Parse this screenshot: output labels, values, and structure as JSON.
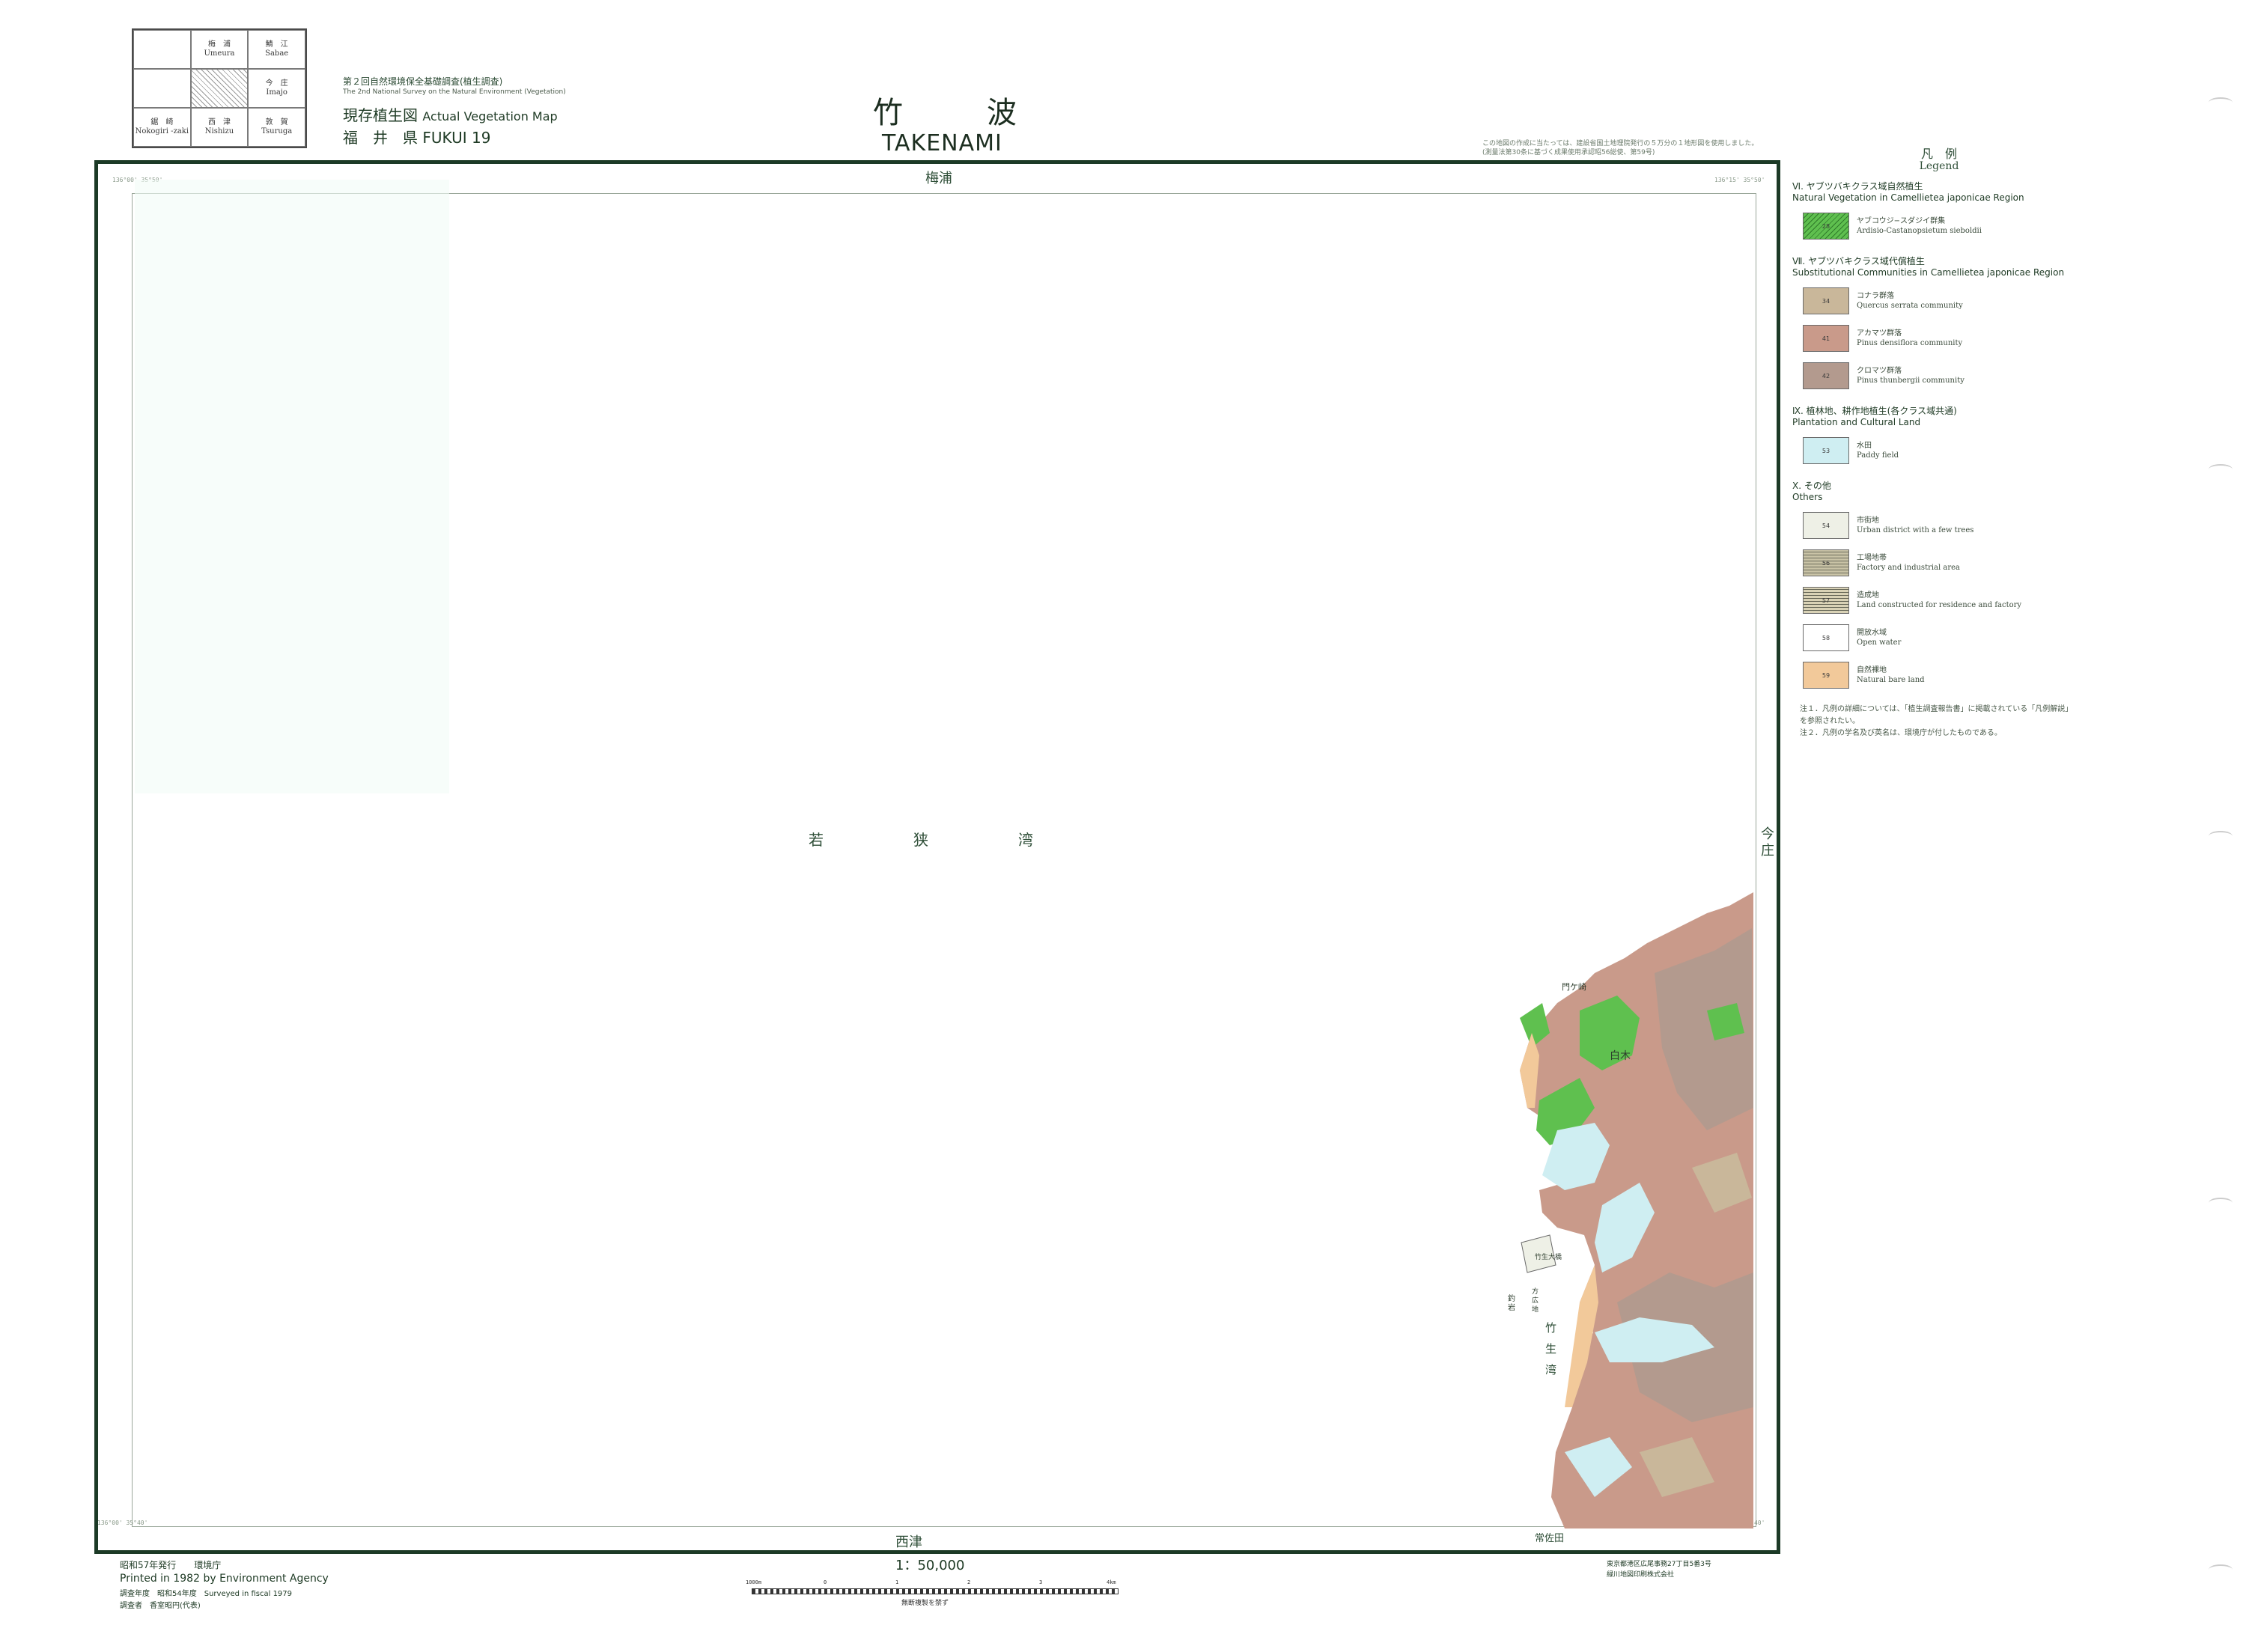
{
  "index_grid": {
    "cells": [
      {
        "jp": "",
        "en": ""
      },
      {
        "jp": "梅　浦",
        "en": "Umeura"
      },
      {
        "jp": "鯖　江",
        "en": "Sabae"
      },
      {
        "jp": "",
        "en": ""
      },
      {
        "jp": "",
        "en": ""
      },
      {
        "jp": "今　庄",
        "en": "Imajo"
      },
      {
        "jp": "鋸　崎",
        "en": "Nokogiri -zaki"
      },
      {
        "jp": "西　津",
        "en": "Nishizu"
      },
      {
        "jp": "敦　賀",
        "en": "Tsuruga"
      }
    ]
  },
  "header": {
    "survey_jp": "第２回自然環境保全基礎調査(植生調査)",
    "survey_en": "The 2nd National Survey on the Natural Environment (Vegetation)",
    "map_type_jp": "現存植生図",
    "map_type_en": "Actual Vegetation Map",
    "prefecture": "福　井　県 FUKUI 19",
    "title_jp": "竹　波",
    "title_en": "TAKENAMI",
    "note": "この地図の作成に当たっては、建設省国土地理院発行の５万分の１地形図を使用しました。(測量法第30条に基づく成果使用承認昭56総使、第59号)"
  },
  "map": {
    "edge_top": "梅浦",
    "edge_bottom_left": "西津",
    "edge_bottom_right": "常佐田",
    "edge_right": "今庄",
    "sea_label": "若　狭　湾",
    "bay_label": "竹生湾",
    "place_labels": [
      "白木",
      "門ケ崎",
      "竹生大橋",
      "釣岩",
      "方広地"
    ],
    "corner_coords": {
      "top_left": "136°00' 35°50'",
      "top_right": "136°15' 35°50'",
      "bottom_left": "136°00' 35°40'",
      "bottom_right": "136°15' 35°40'"
    }
  },
  "legend": {
    "title_jp": "凡　例",
    "title_en": "Legend",
    "sections": [
      {
        "heading_jp": "Ⅵ. ヤブツバキクラス域自然植生",
        "heading_en": "Natural Vegetation in Camellietea japonicae Region",
        "items": [
          {
            "code": "28",
            "jp": "ヤブコウジ−スダジイ群集",
            "en": "Ardisio-Castanopsietum sieboldii",
            "color": "#5fc04f",
            "pattern": "hatch"
          }
        ]
      },
      {
        "heading_jp": "Ⅶ. ヤブツバキクラス域代償植生",
        "heading_en": "Substitutional Communities in Camellietea japonicae Region",
        "items": [
          {
            "code": "34",
            "jp": "コナラ群落",
            "en": "Quercus serrata community",
            "color": "#c9b79a",
            "pattern": "solid"
          },
          {
            "code": "41",
            "jp": "アカマツ群落",
            "en": "Pinus densiflora community",
            "color": "#c99a8a",
            "pattern": "solid"
          },
          {
            "code": "42",
            "jp": "クロマツ群落",
            "en": "Pinus thunbergii community",
            "color": "#b39a8e",
            "pattern": "solid"
          }
        ]
      },
      {
        "heading_jp": "Ⅸ. 植林地、耕作地植生(各クラス域共通)",
        "heading_en": "Plantation and Cultural Land",
        "items": [
          {
            "code": "53",
            "jp": "水田",
            "en": "Paddy field",
            "color": "#cfeef2",
            "pattern": "solid"
          }
        ]
      },
      {
        "heading_jp": "Ⅹ. その他",
        "heading_en": "Others",
        "items": [
          {
            "code": "54",
            "jp": "市街地",
            "en": "Urban district with a few trees",
            "color": "#eef0e6",
            "pattern": "solid"
          },
          {
            "code": "56",
            "jp": "工場地帯",
            "en": "Factory and industrial area",
            "color": "#c9c3a6",
            "pattern": "lines"
          },
          {
            "code": "57",
            "jp": "造成地",
            "en": "Land constructed for residence and factory",
            "color": "#d9d2b6",
            "pattern": "lines"
          },
          {
            "code": "58",
            "jp": "開放水域",
            "en": "Open water",
            "color": "#ffffff",
            "pattern": "solid"
          },
          {
            "code": "59",
            "jp": "自然裸地",
            "en": "Natural bare land",
            "color": "#f2c99a",
            "pattern": "solid"
          }
        ]
      }
    ],
    "notes": [
      "注１．凡例の詳細については、「植生調査報告書」に掲載されている「凡例解説」を参照されたい。",
      "注２．凡例の学名及び英名は、環境庁が付したものである。"
    ]
  },
  "footer": {
    "published_jp": "昭和57年発行　　環境庁",
    "printed_en": "Printed in 1982 by Environment Agency",
    "surveyed": "調査年度　昭和54年度　Surveyed in fiscal 1979",
    "surveyor": "調査者　香室昭円(代表)",
    "scale": "1：50,000",
    "scale_ticks": [
      "1000m",
      "0",
      "1",
      "2",
      "3",
      "4km"
    ],
    "copy_note": "無断複製を禁ず",
    "printer_1": "東京都港区広尾事務27丁目5番3号",
    "printer_2": "緑川地図印刷株式会社"
  },
  "colors": {
    "frame": "#1c3a26",
    "sea": "#ffffff",
    "forest_natural": "#5fc04f",
    "konara": "#c9b79a",
    "akamatsu": "#c99a8a",
    "kuromatsu": "#b39a8e",
    "paddy": "#cfeef2",
    "bare": "#f2c99a"
  }
}
